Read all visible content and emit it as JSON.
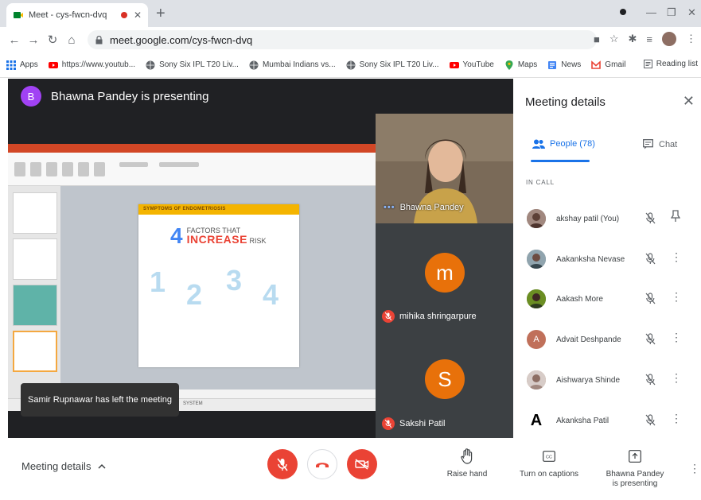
{
  "browser": {
    "tab_title": "Meet - cys-fwcn-dvq",
    "tab_close": "✕",
    "new_tab": "+",
    "url": "meet.google.com/cys-fwcn-dvq",
    "bookmarks": [
      {
        "label": "Apps",
        "icon": "apps-grid-icon"
      },
      {
        "label": "https://www.youtub...",
        "icon": "youtube-icon"
      },
      {
        "label": "Sony Six IPL T20 Liv...",
        "icon": "globe-icon"
      },
      {
        "label": "Mumbai Indians vs...",
        "icon": "globe-icon"
      },
      {
        "label": "Sony Six IPL T20 Liv...",
        "icon": "globe-icon"
      },
      {
        "label": "YouTube",
        "icon": "youtube-icon"
      },
      {
        "label": "Maps",
        "icon": "maps-pin-icon"
      },
      {
        "label": "News",
        "icon": "news-icon"
      },
      {
        "label": "Gmail",
        "icon": "gmail-icon"
      }
    ],
    "reading_list": "Reading list"
  },
  "meet": {
    "presenting_banner": "Bhawna Pandey is presenting",
    "presenter_initial": "B",
    "presenter_tile_name": "Bhawna Pandey",
    "tiles": [
      {
        "initial": "m",
        "name": "mihika shringarpure"
      },
      {
        "initial": "S",
        "name": "Sakshi Patil"
      }
    ],
    "toast": "Samir Rupnawar has left the meeting",
    "slide": {
      "header": "SYMPTOMS OF ENDOMETRIOSIS",
      "big_number": "4",
      "line1": "FACTORS THAT",
      "line2_strong": "INCREASE",
      "line2_rest": " RISK",
      "numbers": [
        "1",
        "2",
        "3",
        "4"
      ]
    },
    "ppt_status_text": "SYSTEM"
  },
  "panel": {
    "title": "Meeting details",
    "close": "✕",
    "tab_people": "People (78)",
    "tab_chat": "Chat",
    "section": "IN CALL",
    "people": [
      {
        "name": "akshay patil (You)",
        "avatar_color": "#8d6e63",
        "initial": "",
        "action": "pin"
      },
      {
        "name": "Aakanksha Nevase",
        "avatar_color": "#7b8b8e",
        "initial": "",
        "action": "more"
      },
      {
        "name": "Aakash More",
        "avatar_color": "#556b2f",
        "initial": "",
        "action": "more"
      },
      {
        "name": "Advait Deshpande",
        "avatar_color": "#c0705a",
        "initial": "A",
        "action": "more"
      },
      {
        "name": "Aishwarya Shinde",
        "avatar_color": "#b08968",
        "initial": "",
        "action": "more"
      },
      {
        "name": "Akanksha Patil",
        "avatar_color": "#ffffff",
        "initial": "A",
        "action": "more"
      }
    ]
  },
  "controls": {
    "meeting_details": "Meeting details",
    "raise_hand": "Raise hand",
    "captions": "Turn on captions",
    "present_line1": "Bhawna Pandey",
    "present_line2": "is presenting"
  },
  "colors": {
    "accent": "#1a73e8",
    "danger": "#ea4335",
    "stage_bg": "#202124",
    "tile_orange": "#e8710a"
  }
}
